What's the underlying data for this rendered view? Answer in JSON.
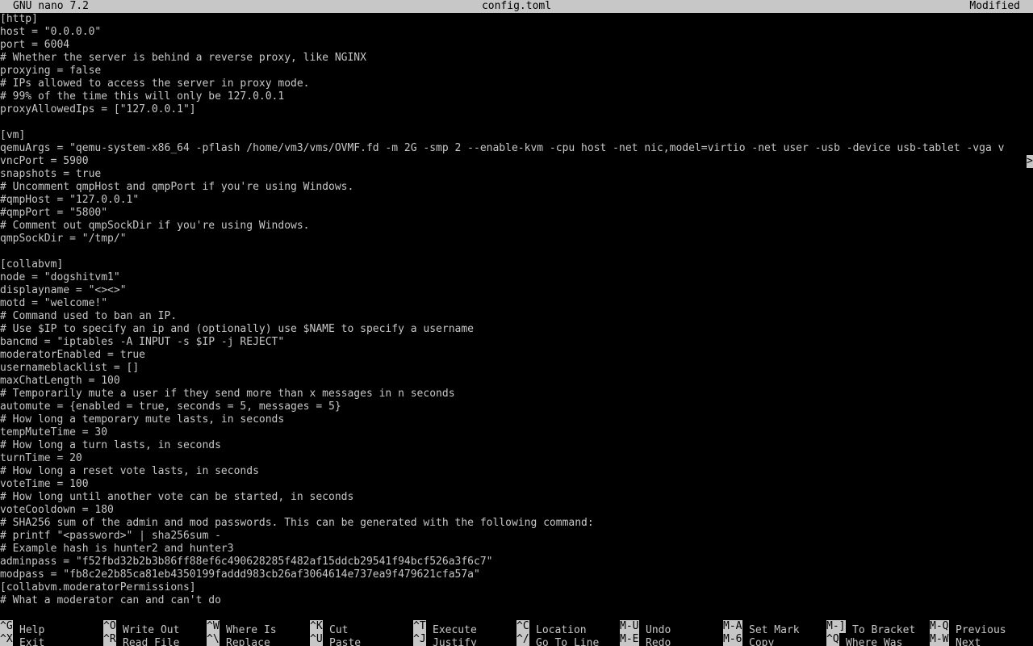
{
  "titlebar": {
    "app": "GNU nano 7.2",
    "filename": "config.toml",
    "status": "Modified"
  },
  "editor": {
    "lines": [
      "[http]",
      "host = \"0.0.0.0\"",
      "port = 6004",
      "# Whether the server is behind a reverse proxy, like NGINX",
      "proxying = false",
      "# IPs allowed to access the server in proxy mode.",
      "# 99% of the time this will only be 127.0.0.1",
      "proxyAllowedIps = [\"127.0.0.1\"]",
      "",
      "[vm]",
      "qemuArgs = \"qemu-system-x86_64 -pflash /home/vm3/vms/OVMF.fd -m 2G -smp 2 --enable-kvm -cpu host -net nic,model=virtio -net user -usb -device usb-tablet -vga v",
      "vncPort = 5900",
      "snapshots = true",
      "# Uncomment qmpHost and qmpPort if you're using Windows.",
      "#qmpHost = \"127.0.0.1\"",
      "#qmpPort = \"5800\"",
      "# Comment out qmpSockDir if you're using Windows.",
      "qmpSockDir = \"/tmp/\"",
      "",
      "[collabvm]",
      "node = \"dogshitvm1\"",
      "displayname = \"<><>\"",
      "motd = \"welcome!\"",
      "# Command used to ban an IP.",
      "# Use $IP to specify an ip and (optionally) use $NAME to specify a username",
      "bancmd = \"iptables -A INPUT -s $IP -j REJECT\"",
      "moderatorEnabled = true",
      "usernameblacklist = []",
      "maxChatLength = 100",
      "# Temporarily mute a user if they send more than x messages in n seconds",
      "automute = {enabled = true, seconds = 5, messages = 5}",
      "# How long a temporary mute lasts, in seconds",
      "tempMuteTime = 30",
      "# How long a turn lasts, in seconds",
      "turnTime = 20",
      "# How long a reset vote lasts, in seconds",
      "voteTime = 100",
      "# How long until another vote can be started, in seconds",
      "voteCooldown = 180",
      "# SHA256 sum of the admin and mod passwords. This can be generated with the following command:",
      "# printf \"<password>\" | sha256sum -",
      "# Example hash is hunter2 and hunter3",
      "adminpass = \"f52fbd32b2b3b86ff88ef6c490628285f482af15ddcb29541f94bcf526a3f6c7\"",
      "modpass = \"fb8c2e2b85ca81eb4350199faddd983cb26af3064614e737ea9f479621cfa57a\"",
      "[collabvm.moderatorPermissions]",
      "# What a moderator can and can't do"
    ],
    "overflow_marker": ">"
  },
  "shortcuts": [
    {
      "key": "^G",
      "label": "Help"
    },
    {
      "key": "^X",
      "label": "Exit"
    },
    {
      "key": "^O",
      "label": "Write Out"
    },
    {
      "key": "^R",
      "label": "Read File"
    },
    {
      "key": "^W",
      "label": "Where Is"
    },
    {
      "key": "^\\",
      "label": "Replace"
    },
    {
      "key": "^K",
      "label": "Cut"
    },
    {
      "key": "^U",
      "label": "Paste"
    },
    {
      "key": "^T",
      "label": "Execute"
    },
    {
      "key": "^J",
      "label": "Justify"
    },
    {
      "key": "^C",
      "label": "Location"
    },
    {
      "key": "^/",
      "label": "Go To Line"
    },
    {
      "key": "M-U",
      "label": "Undo"
    },
    {
      "key": "M-E",
      "label": "Redo"
    },
    {
      "key": "M-A",
      "label": "Set Mark"
    },
    {
      "key": "M-6",
      "label": "Copy"
    },
    {
      "key": "M-]",
      "label": "To Bracket"
    },
    {
      "key": "^Q",
      "label": "Where Was"
    },
    {
      "key": "M-Q",
      "label": "Previous"
    },
    {
      "key": "M-W",
      "label": "Next"
    }
  ],
  "colors": {
    "background": "#000000",
    "foreground": "#c7c7c7",
    "inverse_bg": "#c7c7c7",
    "inverse_fg": "#000000"
  }
}
